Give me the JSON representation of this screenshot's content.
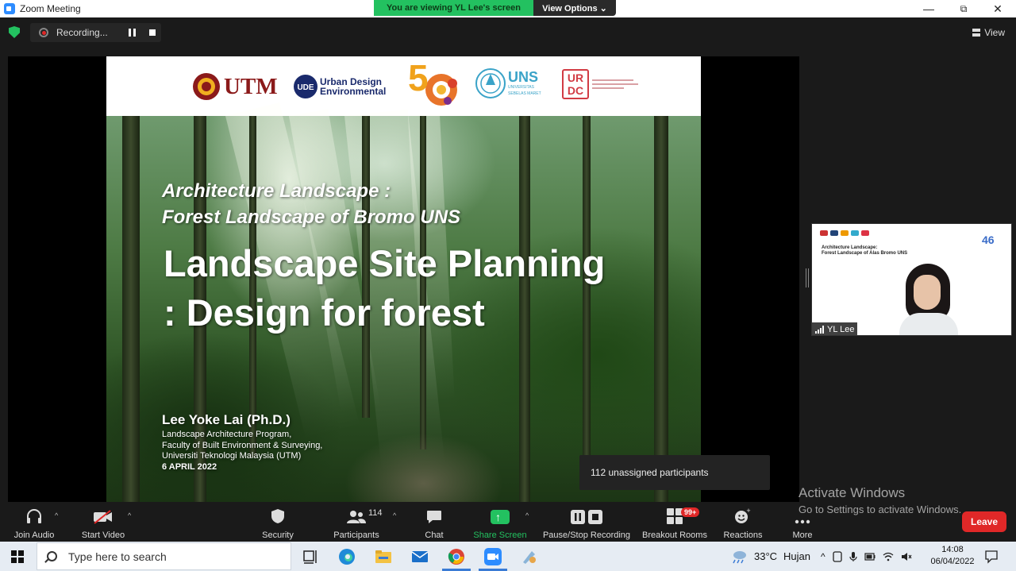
{
  "window": {
    "title": "Zoom Meeting",
    "minimize": "—",
    "restore": "⧉",
    "close": "✕"
  },
  "banner": {
    "viewing": "You are viewing YL Lee's screen",
    "view_options": "View Options ⌄"
  },
  "topbar": {
    "recording_label": "Recording...",
    "view_label": "View"
  },
  "slide": {
    "logos": [
      "UTM",
      "Urban Design",
      "Environmental",
      "5",
      "UNS",
      "UNIVERSITAS",
      "SEBELAS MARET",
      "UR",
      "DC"
    ],
    "subtitle_line1": "Architecture Landscape :",
    "subtitle_line2": "Forest Landscape of Bromo UNS",
    "title_line1": "Landscape Site Planning",
    "title_line2": ": Design for forest",
    "author": "Lee Yoke Lai (Ph.D.)",
    "affiliation_line1": "Landscape Architecture Program,",
    "affiliation_line2": "Faculty of Built Environment & Surveying,",
    "affiliation_line3": "Universiti Teknologi Malaysia (UTM)",
    "date": "6 APRIL 2022"
  },
  "toast": {
    "text": "112 unassigned participants"
  },
  "video_tile": {
    "slide_title_line1": "Architecture Landscape:",
    "slide_title_line2": "Forest Landscape of Alas Bromo UNS",
    "badge": "46",
    "participant_name": "YL Lee"
  },
  "toolbar": {
    "join_audio": "Join Audio",
    "start_video": "Start Video",
    "security": "Security",
    "participants": "Participants",
    "participants_count": "114",
    "chat": "Chat",
    "share_screen": "Share Screen",
    "pause_stop_recording": "Pause/Stop Recording",
    "breakout_rooms": "Breakout Rooms",
    "breakout_badge": "99+",
    "reactions": "Reactions",
    "more": "More",
    "leave": "Leave"
  },
  "watermark": {
    "line1": "Activate Windows",
    "line2": "Go to Settings to activate Windows."
  },
  "taskbar": {
    "search_placeholder": "Type here to search",
    "weather_temp": "33°C",
    "weather_text": "Hujan",
    "time": "14:08",
    "date": "06/04/2022"
  },
  "colors": {
    "zoom_green": "#23c160",
    "leave_red": "#e02828",
    "zoom_blue": "#2d8cff"
  }
}
